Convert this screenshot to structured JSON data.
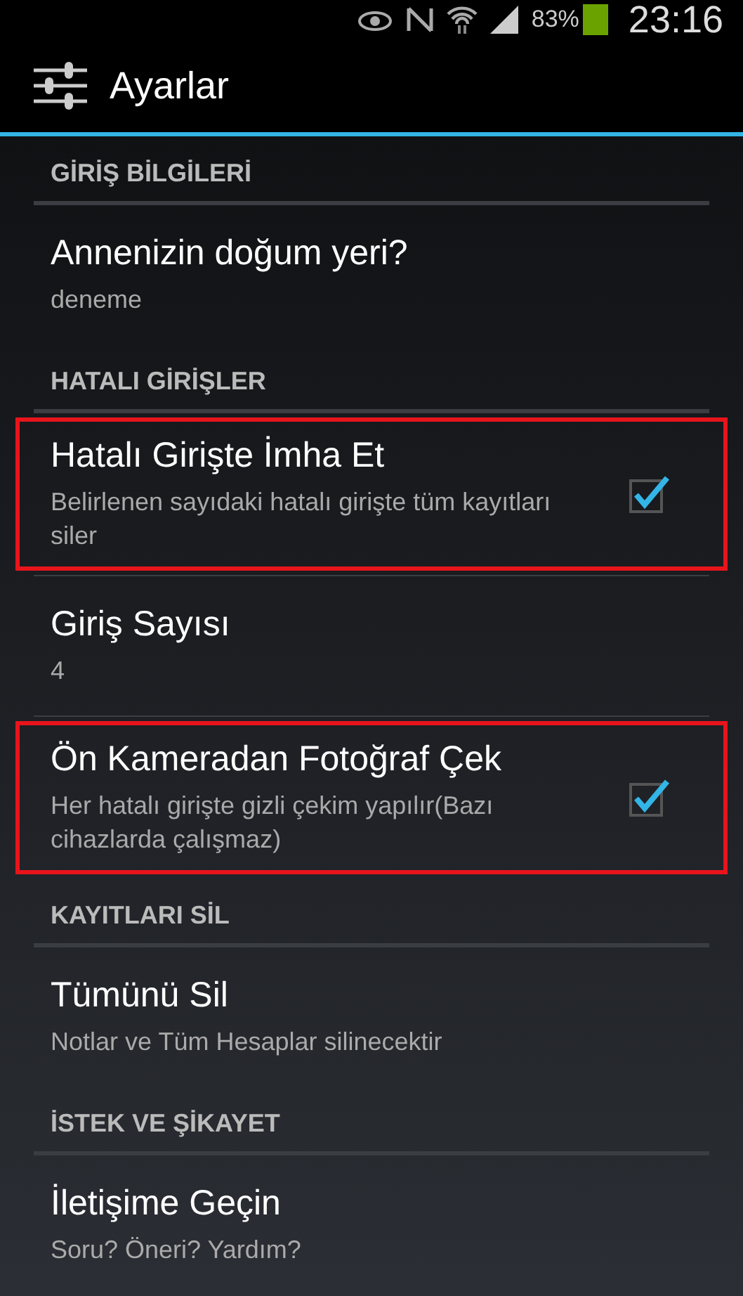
{
  "status_bar": {
    "battery": "83%",
    "time": "23:16"
  },
  "action_bar": {
    "title": "Ayarlar"
  },
  "sections": [
    {
      "header": "GİRİŞ BİLGİLERİ",
      "items": [
        {
          "kind": "text",
          "title": "Annenizin doğum yeri?",
          "summary": "deneme",
          "highlighted": false
        }
      ]
    },
    {
      "header": "HATALI GİRİŞLER",
      "items": [
        {
          "kind": "checkbox",
          "title": "Hatalı Girişte İmha Et",
          "summary": "Belirlenen sayıdaki hatalı girişte tüm kayıtları siler",
          "checked": true,
          "highlighted": true
        },
        {
          "kind": "text",
          "title": "Giriş Sayısı",
          "summary": "4",
          "highlighted": false
        },
        {
          "kind": "checkbox",
          "title": "Ön Kameradan Fotoğraf Çek",
          "summary": "Her hatalı girişte gizli çekim yapılır(Bazı cihazlarda çalışmaz)",
          "checked": true,
          "highlighted": true
        }
      ]
    },
    {
      "header": "KAYITLARI SİL",
      "items": [
        {
          "kind": "text",
          "title": "Tümünü Sil",
          "summary": "Notlar ve Tüm Hesaplar silinecektir",
          "highlighted": false
        }
      ]
    },
    {
      "header": "İSTEK VE ŞİKAYET",
      "items": [
        {
          "kind": "text",
          "title": "İletişime Geçin",
          "summary": "Soru? Öneri? Yardım?",
          "highlighted": false
        }
      ]
    }
  ]
}
